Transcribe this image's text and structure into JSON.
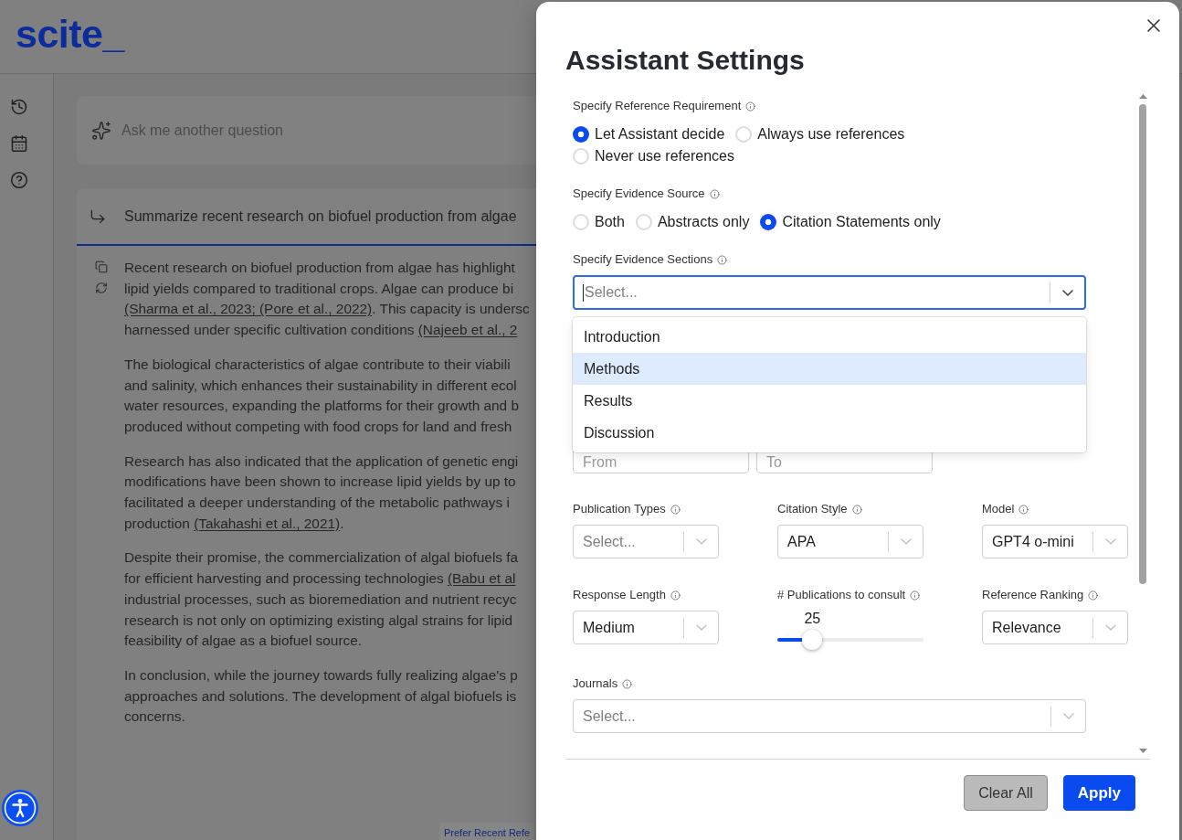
{
  "header": {
    "logo": "scite_"
  },
  "ask_box": {
    "placeholder": "Ask me another question"
  },
  "query": {
    "text": "Summarize recent research on biofuel production from algae"
  },
  "answer": {
    "paragraphs": [
      {
        "lines": [
          [
            {
              "kind": "text",
              "text": "Recent research on biofuel production from algae has highlight"
            }
          ],
          [
            {
              "kind": "text",
              "text": "lipid yields compared to traditional crops. Algae can produce bi"
            }
          ],
          [
            {
              "kind": "citation",
              "text": "(Sharma et al., 2023; (Pore et al., 2022)"
            },
            {
              "kind": "text",
              "text": ". This capacity is undersc"
            }
          ],
          [
            {
              "kind": "text",
              "text": "harnessed under specific cultivation conditions "
            },
            {
              "kind": "citation",
              "text": "(Najeeb et al., 2"
            }
          ]
        ]
      },
      {
        "lines": [
          [
            {
              "kind": "text",
              "text": "The biological characteristics of algae contribute to their viabili"
            }
          ],
          [
            {
              "kind": "text",
              "text": "and salinity, which enhances their sustainability in different ecol"
            }
          ],
          [
            {
              "kind": "text",
              "text": "water resources, expanding the platforms for their growth and b"
            }
          ],
          [
            {
              "kind": "text",
              "text": "produced without competing with food crops for land and fresh"
            }
          ]
        ]
      },
      {
        "lines": [
          [
            {
              "kind": "text",
              "text": "Research has also indicated that the application of genetic engi"
            }
          ],
          [
            {
              "kind": "text",
              "text": "modifications have been shown to increase lipid yields by up to"
            }
          ],
          [
            {
              "kind": "text",
              "text": "facilitated a deeper understanding of the metabolic pathways i"
            }
          ],
          [
            {
              "kind": "text",
              "text": "production "
            },
            {
              "kind": "citation",
              "text": "(Takahashi et al., 2021)"
            },
            {
              "kind": "text",
              "text": "."
            }
          ]
        ]
      },
      {
        "lines": [
          [
            {
              "kind": "text",
              "text": "Despite their promise, the commercialization of algal biofuels fa"
            }
          ],
          [
            {
              "kind": "text",
              "text": "for efficient harvesting and processing technologies "
            },
            {
              "kind": "citation",
              "text": "(Babu et al"
            }
          ],
          [
            {
              "kind": "text",
              "text": "industrial processes, such as bioremediation and nutrient recyc"
            }
          ],
          [
            {
              "kind": "text",
              "text": "research is not only on optimizing existing algal strains for lipid"
            }
          ],
          [
            {
              "kind": "text",
              "text": "feasibility of algae as a biofuel source."
            }
          ]
        ]
      },
      {
        "lines": [
          [
            {
              "kind": "text",
              "text": "In conclusion, while the journey towards fully realizing algae's p"
            }
          ],
          [
            {
              "kind": "text",
              "text": "approaches and solutions. The development of algal biofuels is"
            }
          ],
          [
            {
              "kind": "text",
              "text": "concerns."
            }
          ]
        ]
      }
    ]
  },
  "floating_chip": {
    "label": "Prefer Recent Refe"
  },
  "modal": {
    "title": "Assistant Settings",
    "reference_requirement": {
      "label": "Specify Reference Requirement",
      "options": [
        {
          "label": "Let Assistant decide",
          "selected": true
        },
        {
          "label": "Always use references",
          "selected": false
        },
        {
          "label": "Never use references",
          "selected": false
        }
      ]
    },
    "evidence_source": {
      "label": "Specify Evidence Source",
      "options": [
        {
          "label": "Both",
          "selected": false
        },
        {
          "label": "Abstracts only",
          "selected": false
        },
        {
          "label": "Citation Statements only",
          "selected": true
        }
      ]
    },
    "evidence_sections": {
      "label": "Specify Evidence Sections",
      "placeholder": "Select...",
      "expanded": true,
      "menu": [
        {
          "label": "Introduction",
          "highlighted": false
        },
        {
          "label": "Methods",
          "highlighted": true
        },
        {
          "label": "Results",
          "highlighted": false
        },
        {
          "label": "Discussion",
          "highlighted": false
        }
      ]
    },
    "date_range": [
      {
        "placeholder": "From"
      },
      {
        "placeholder": "To"
      }
    ],
    "options": [
      {
        "kind": "select",
        "label": "Publication Types",
        "placeholder": "Select..."
      },
      {
        "kind": "select",
        "label": "Citation Style",
        "value": "APA"
      },
      {
        "kind": "select",
        "label": "Model",
        "value": "GPT4 o-mini"
      },
      {
        "kind": "select",
        "label": "Response Length",
        "value": "Medium"
      },
      {
        "kind": "slider",
        "label": "# Publications to consult",
        "reading": "25",
        "level": 0.24
      },
      {
        "kind": "select",
        "label": "Reference Ranking",
        "value": "Relevance"
      }
    ],
    "journals": {
      "label": "Journals",
      "placeholder": "Select..."
    },
    "buttons": [
      {
        "kind": "secondary",
        "label": "Clear All"
      },
      {
        "kind": "primary",
        "label": "Apply"
      }
    ]
  }
}
